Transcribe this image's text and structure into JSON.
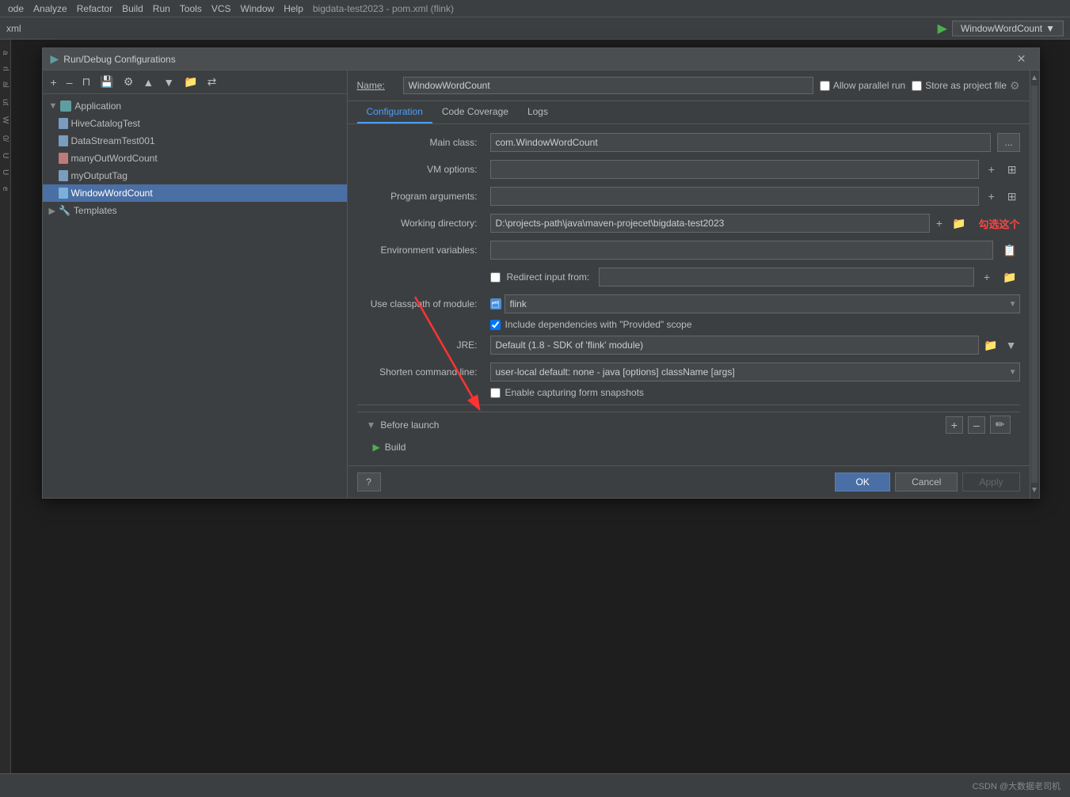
{
  "menubar": {
    "items": [
      "ode",
      "Analyze",
      "Refactor",
      "Build",
      "Run",
      "Tools",
      "VCS",
      "Window",
      "Help"
    ],
    "project_title": "bigdata-test2023 - pom.xml (flink)"
  },
  "topbar": {
    "run_config": "WindowWordCount"
  },
  "dialog": {
    "title": "Run/Debug Configurations",
    "close_label": "✕"
  },
  "toolbar_buttons": [
    "+",
    "–",
    "⊓",
    "💾",
    "🔧",
    "▲",
    "▼",
    "📁",
    "⇄"
  ],
  "tree": {
    "items": [
      {
        "label": "Application",
        "type": "group",
        "indent": 0,
        "expanded": true
      },
      {
        "label": "HiveCatalogTest",
        "type": "file",
        "indent": 1
      },
      {
        "label": "DataStreamTest001",
        "type": "file",
        "indent": 1
      },
      {
        "label": "manyOutWordCount",
        "type": "file-red",
        "indent": 1
      },
      {
        "label": "myOutputTag",
        "type": "file",
        "indent": 1
      },
      {
        "label": "WindowWordCount",
        "type": "file",
        "indent": 1,
        "selected": true
      },
      {
        "label": "Templates",
        "type": "templates",
        "indent": 0,
        "expanded": false
      }
    ]
  },
  "name_row": {
    "label": "Name:",
    "value": "WindowWordCount",
    "allow_parallel_label": "Allow parallel run",
    "store_project_label": "Store as project file"
  },
  "tabs": [
    {
      "label": "Configuration",
      "active": true
    },
    {
      "label": "Code Coverage",
      "active": false
    },
    {
      "label": "Logs",
      "active": false
    }
  ],
  "form": {
    "main_class_label": "Main class:",
    "main_class_value": "com.WindowWordCount",
    "main_class_btn": "...",
    "vm_options_label": "VM options:",
    "vm_options_value": "",
    "program_args_label": "Program arguments:",
    "program_args_value": "",
    "working_dir_label": "Working directory:",
    "working_dir_value": "D:\\projects-path\\java\\maven-projecet\\bigdata-test2023",
    "env_vars_label": "Environment variables:",
    "env_vars_value": "",
    "redirect_label": "Redirect input from:",
    "redirect_value": "",
    "classpath_label": "Use classpath of module:",
    "classpath_value": "flink",
    "include_deps_label": "Include dependencies with \"Provided\" scope",
    "include_deps_checked": true,
    "jre_label": "JRE:",
    "jre_default": "Default",
    "jre_hint": "(1.8 - SDK of 'flink' module)",
    "shorten_cmd_label": "Shorten command line:",
    "shorten_cmd_value": "user-local default: none - java [options] className [args]",
    "enable_capturing_label": "Enable capturing form snapshots",
    "enable_capturing_checked": false
  },
  "before_launch": {
    "title": "Before launch",
    "items": [
      {
        "icon": "▶",
        "label": "Build"
      }
    ],
    "add_label": "+"
  },
  "footer": {
    "question_label": "?",
    "ok_label": "OK",
    "cancel_label": "Cancel",
    "apply_label": "Apply"
  },
  "annotation": {
    "text": "勾选这个"
  },
  "watermark": "CSDN @大数据老司机"
}
